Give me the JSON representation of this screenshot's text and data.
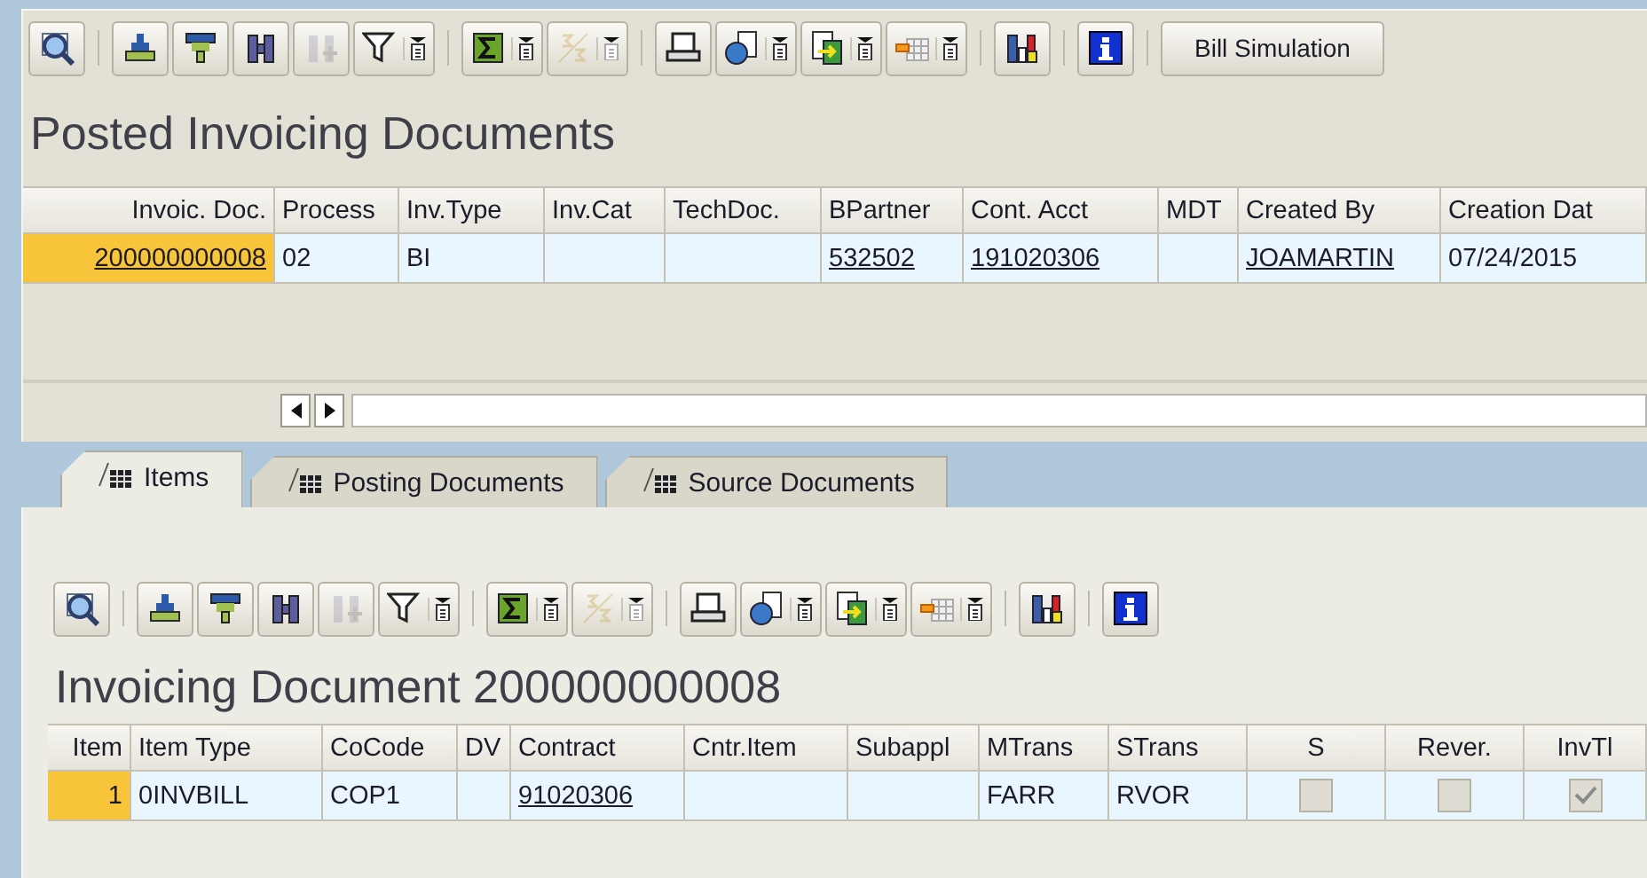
{
  "top_toolbar": {
    "items": [
      {
        "kind": "button",
        "disabled": false,
        "menu": false
      },
      {
        "kind": "separator"
      },
      {
        "kind": "button",
        "disabled": false,
        "menu": false
      },
      {
        "kind": "button",
        "disabled": false,
        "menu": false
      },
      {
        "kind": "button",
        "disabled": false,
        "menu": false
      },
      {
        "kind": "button",
        "disabled": true,
        "menu": false
      },
      {
        "kind": "button",
        "disabled": false,
        "menu": true
      },
      {
        "kind": "separator"
      },
      {
        "kind": "button",
        "disabled": false,
        "menu": true
      },
      {
        "kind": "button",
        "disabled": true,
        "menu": true
      },
      {
        "kind": "separator"
      },
      {
        "kind": "button",
        "disabled": false,
        "menu": false
      },
      {
        "kind": "button",
        "disabled": false,
        "menu": true
      },
      {
        "kind": "button",
        "disabled": false,
        "menu": true
      },
      {
        "kind": "button",
        "disabled": false,
        "menu": true
      },
      {
        "kind": "separator"
      },
      {
        "kind": "button",
        "disabled": false,
        "menu": false
      },
      {
        "kind": "separator"
      },
      {
        "kind": "button",
        "disabled": false,
        "menu": false
      },
      {
        "kind": "separator"
      },
      {
        "kind": "text",
        "label": "Bill Simulation"
      }
    ]
  },
  "top_title": "Posted Invoicing Documents",
  "top_table": {
    "columns": [
      {
        "label": "Invoic. Doc.",
        "kind": "key"
      },
      {
        "label": "Process"
      },
      {
        "label": "Inv.Type"
      },
      {
        "label": "Inv.Cat"
      },
      {
        "label": "TechDoc."
      },
      {
        "label": "BPartner"
      },
      {
        "label": "Cont. Acct"
      },
      {
        "label": "MDT"
      },
      {
        "label": "Created By"
      },
      {
        "label": "Creation Dat"
      }
    ],
    "rows": [
      [
        {
          "kind": "link",
          "text": "200000000008",
          "highlighted": true
        },
        {
          "kind": "text",
          "text": "02"
        },
        {
          "kind": "text",
          "text": "BI"
        },
        null,
        null,
        {
          "kind": "link",
          "text": "532502"
        },
        {
          "kind": "link",
          "text": "191020306"
        },
        null,
        {
          "kind": "link",
          "text": "JOAMARTIN"
        },
        {
          "kind": "text",
          "text": "07/24/2015"
        }
      ]
    ]
  },
  "tabs": [
    {
      "label": "Items",
      "selected": true
    },
    {
      "label": "Posting Documents",
      "selected": false
    },
    {
      "label": "Source Documents",
      "selected": false
    }
  ],
  "bottom_toolbar": {
    "items": [
      {
        "kind": "button",
        "disabled": false,
        "menu": false
      },
      {
        "kind": "separator"
      },
      {
        "kind": "button",
        "disabled": false,
        "menu": false
      },
      {
        "kind": "button",
        "disabled": false,
        "menu": false
      },
      {
        "kind": "button",
        "disabled": false,
        "menu": false
      },
      {
        "kind": "button",
        "disabled": true,
        "menu": false
      },
      {
        "kind": "button",
        "disabled": false,
        "menu": true
      },
      {
        "kind": "separator"
      },
      {
        "kind": "button",
        "disabled": false,
        "menu": true
      },
      {
        "kind": "button",
        "disabled": true,
        "menu": true
      },
      {
        "kind": "separator"
      },
      {
        "kind": "button",
        "disabled": false,
        "menu": false
      },
      {
        "kind": "button",
        "disabled": false,
        "menu": true
      },
      {
        "kind": "button",
        "disabled": false,
        "menu": true
      },
      {
        "kind": "button",
        "disabled": false,
        "menu": true
      },
      {
        "kind": "separator"
      },
      {
        "kind": "button",
        "disabled": false,
        "menu": false
      },
      {
        "kind": "separator"
      },
      {
        "kind": "button",
        "disabled": false,
        "menu": false
      }
    ]
  },
  "bottom_title": "Invoicing Document 200000000008",
  "bottom_table": {
    "columns": [
      {
        "label": "Item",
        "kind": "key"
      },
      {
        "label": "Item Type"
      },
      {
        "label": "CoCode"
      },
      {
        "label": "DV"
      },
      {
        "label": "Contract"
      },
      {
        "label": "Cntr.Item"
      },
      {
        "label": "Subappl"
      },
      {
        "label": "MTrans"
      },
      {
        "label": "STrans"
      },
      {
        "label": "S",
        "kind": "flag"
      },
      {
        "label": "Rever.",
        "kind": "flag"
      },
      {
        "label": "InvTl",
        "kind": "flag"
      }
    ],
    "rows": [
      [
        {
          "kind": "text",
          "text": "1",
          "highlighted": true
        },
        {
          "kind": "text",
          "text": "0INVBILL"
        },
        {
          "kind": "text",
          "text": "COP1"
        },
        null,
        {
          "kind": "link",
          "text": "91020306"
        },
        null,
        null,
        {
          "kind": "text",
          "text": "FARR"
        },
        {
          "kind": "text",
          "text": "RVOR"
        },
        {
          "kind": "checkbox",
          "checked": false,
          "disabled": true
        },
        {
          "kind": "checkbox",
          "checked": false,
          "disabled": true
        },
        {
          "kind": "checkbox",
          "checked": true,
          "disabled": true
        }
      ]
    ]
  }
}
